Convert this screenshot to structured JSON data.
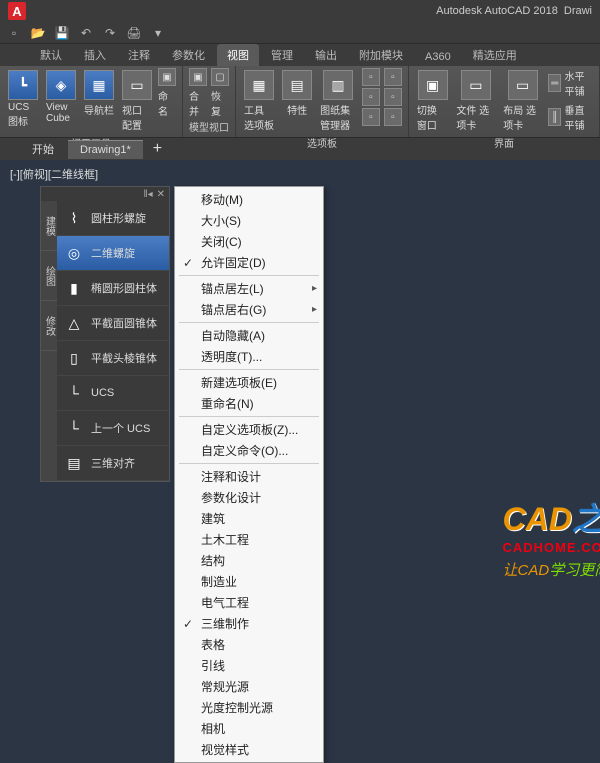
{
  "titlebar": {
    "app": "A",
    "title": "Autodesk AutoCAD 2018",
    "doc": "Drawi"
  },
  "menutabs": [
    "默认",
    "插入",
    "注释",
    "参数化",
    "视图",
    "管理",
    "输出",
    "附加模块",
    "A360",
    "精选应用"
  ],
  "ribbon": {
    "p1": {
      "b1": "UCS\n图标",
      "b2": "View\nCube",
      "b3": "导航栏",
      "b4": "视口\n配置",
      "s1": "命名",
      "label": "视口工具"
    },
    "p2": {
      "b1": "合并",
      "b2": "恢复",
      "label": "模型视口"
    },
    "p3": {
      "b1": "工具\n选项板",
      "b2": "特性",
      "b3": "图纸集\n管理器",
      "label": "选项板"
    },
    "p4": {
      "b1": "切换\n窗口",
      "b2": "文件\n选项卡",
      "b3": "布局\n选项卡",
      "b4": "水平平铺",
      "b5": "垂直平铺",
      "label": "界面"
    }
  },
  "filetabs": {
    "t1": "开始",
    "t2": "Drawing1*"
  },
  "vclabel": "[-][俯视][二维线框]",
  "palette": {
    "tabs": [
      "建模",
      "绘图",
      "修改"
    ],
    "items": [
      {
        "icon": "⌇",
        "label": "圆柱形螺旋"
      },
      {
        "icon": "◎",
        "label": "二维螺旋"
      },
      {
        "icon": "▮",
        "label": "椭圆形圆柱体"
      },
      {
        "icon": "△",
        "label": "平截面圆锥体"
      },
      {
        "icon": "▯",
        "label": "平截头棱锥体"
      },
      {
        "icon": "└",
        "label": "UCS"
      },
      {
        "icon": "└",
        "label": "上一个 UCS"
      },
      {
        "icon": "▤",
        "label": "三维对齐"
      }
    ]
  },
  "menu": [
    {
      "t": "移动(M)"
    },
    {
      "t": "大小(S)"
    },
    {
      "t": "关闭(C)"
    },
    {
      "t": "允许固定(D)",
      "c": true
    },
    {
      "sep": true
    },
    {
      "t": "锚点居左(L)",
      "sub": true
    },
    {
      "t": "锚点居右(G)",
      "sub": true
    },
    {
      "sep": true
    },
    {
      "t": "自动隐藏(A)"
    },
    {
      "t": "透明度(T)..."
    },
    {
      "sep": true
    },
    {
      "t": "新建选项板(E)"
    },
    {
      "t": "重命名(N)"
    },
    {
      "sep": true
    },
    {
      "t": "自定义选项板(Z)..."
    },
    {
      "t": "自定义命令(O)..."
    },
    {
      "sep": true
    },
    {
      "t": "注释和设计"
    },
    {
      "t": "参数化设计"
    },
    {
      "t": "建筑"
    },
    {
      "t": "土木工程"
    },
    {
      "t": "结构"
    },
    {
      "t": "制造业"
    },
    {
      "t": "电气工程"
    },
    {
      "t": "三维制作",
      "c": true
    },
    {
      "t": "表格"
    },
    {
      "t": "引线"
    },
    {
      "t": "常规光源"
    },
    {
      "t": "光度控制光源"
    },
    {
      "t": "相机"
    },
    {
      "t": "视觉样式"
    }
  ],
  "watermark": {
    "l1a": "CAD",
    "l1b": "之家",
    "l2": "CADHOME.COM.CN",
    "l3a": "让",
    "l3b": "CAD",
    "l3c": "学习更简单！"
  }
}
